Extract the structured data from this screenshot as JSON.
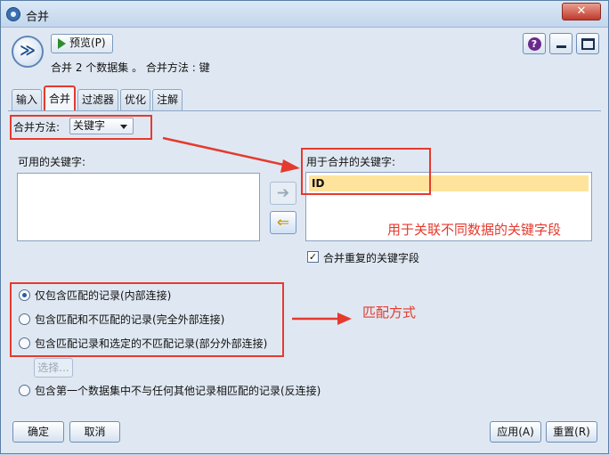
{
  "window": {
    "title": "合并"
  },
  "header": {
    "preview_label": "预览(P)",
    "summary": "合并 2 个数据集 。 合并方法 : 键"
  },
  "tabs": [
    {
      "label": "输入"
    },
    {
      "label": "合并"
    },
    {
      "label": "过滤器"
    },
    {
      "label": "优化"
    },
    {
      "label": "注解"
    }
  ],
  "merge": {
    "method_label": "合并方法:",
    "method_value": "关键字",
    "available_label": "可用的关键字:",
    "used_label": "用于合并的关键字:",
    "used_keys": [
      "ID"
    ],
    "combine_dup_label": "合并重复的关键字段",
    "combine_dup_checked": true
  },
  "join_options": [
    {
      "label": "仅包含匹配的记录(内部连接)",
      "checked": true
    },
    {
      "label": "包含匹配和不匹配的记录(完全外部连接)",
      "checked": false
    },
    {
      "label": "包含匹配记录和选定的不匹配记录(部分外部连接)",
      "checked": false
    }
  ],
  "select_label": "选择...",
  "anti_join_label": "包含第一个数据集中不与任何其他记录相匹配的记录(反连接)",
  "footer": {
    "ok": "确定",
    "cancel": "取消",
    "apply": "应用(A)",
    "reset": "重置(R)"
  },
  "annotations": {
    "key_field_note": "用于关联不同数据的关键字段",
    "match_mode_note": "匹配方式"
  },
  "colors": {
    "annotation": "#e53a2e",
    "selected_row": "#fde39c"
  }
}
